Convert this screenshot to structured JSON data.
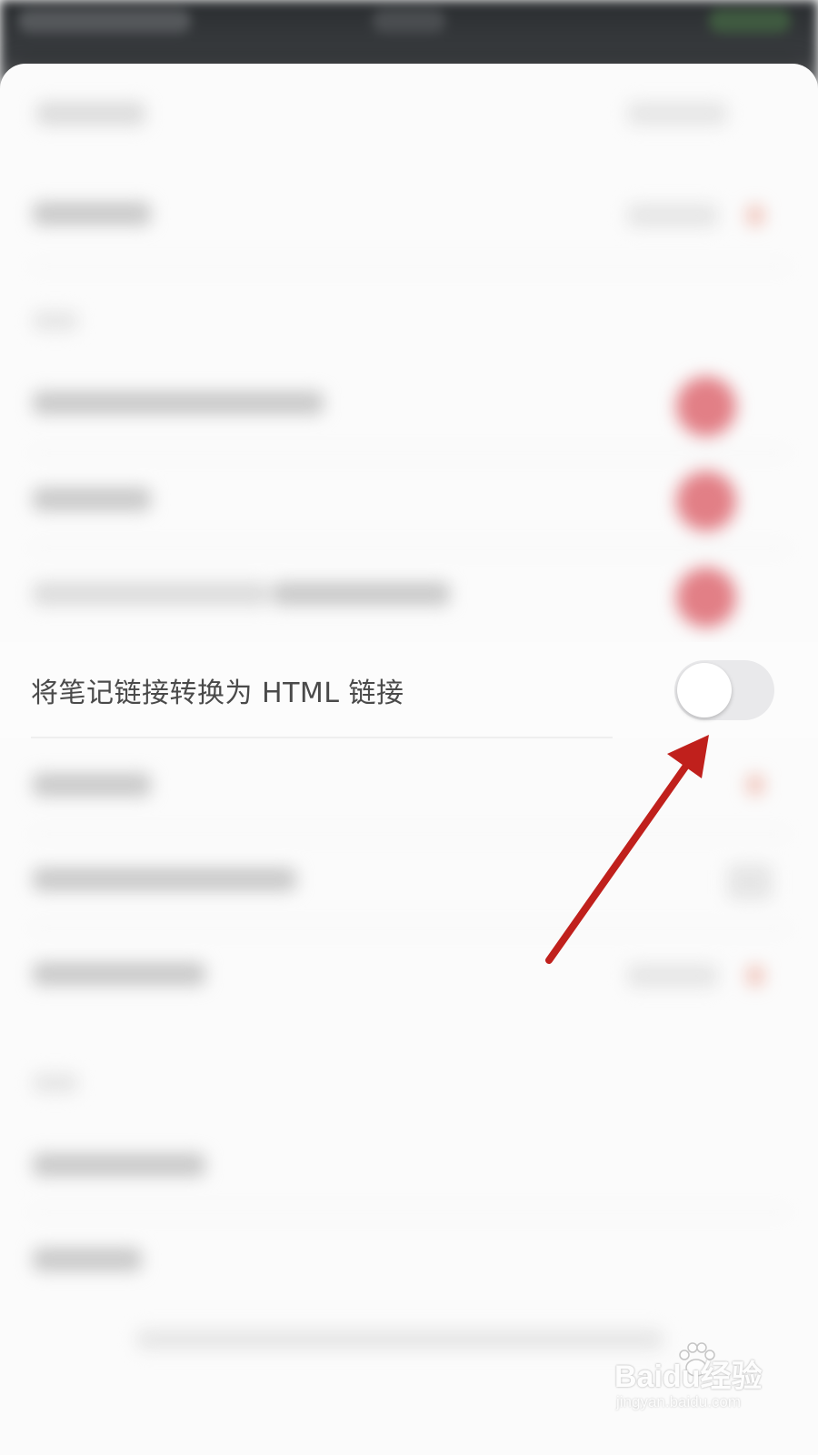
{
  "setting": {
    "label": "将笔记链接转换为 HTML 链接",
    "enabled": false
  },
  "colors": {
    "toggle_off_track": "#e9e9eb",
    "toggle_knob": "#ffffff",
    "accent_red": "#e27f86",
    "annotation_arrow": "#c0201c"
  },
  "watermark": {
    "brand": "Baidu经验",
    "site": "jingyan.baidu.com"
  },
  "icons": {
    "watermark_logo": "paw-icon"
  }
}
